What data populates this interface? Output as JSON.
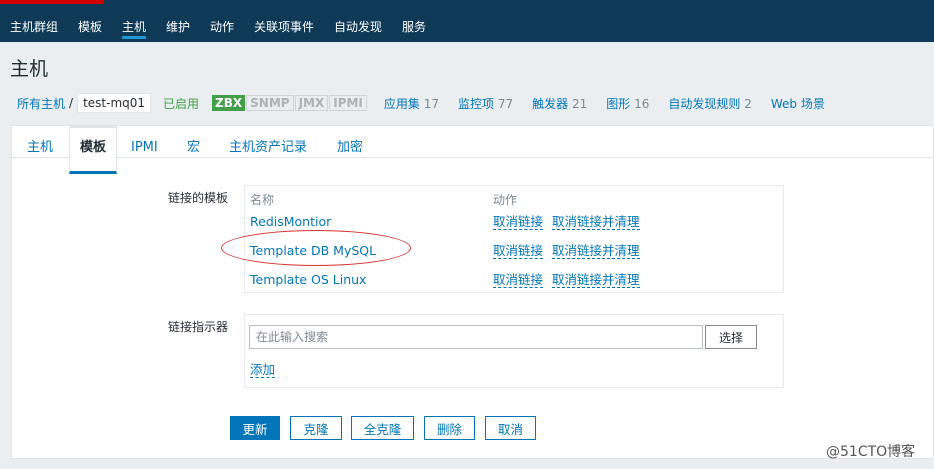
{
  "nav": {
    "items": [
      {
        "label": "主机群组"
      },
      {
        "label": "模板"
      },
      {
        "label": "主机"
      },
      {
        "label": "维护"
      },
      {
        "label": "动作"
      },
      {
        "label": "关联项事件"
      },
      {
        "label": "自动发现"
      },
      {
        "label": "服务"
      }
    ]
  },
  "page": {
    "title": "主机"
  },
  "breadcrumb": {
    "all_hosts": "所有主机",
    "separator": "/",
    "current": "test-mq01",
    "status": "已启用",
    "badges": [
      "ZBX",
      "SNMP",
      "JMX",
      "IPMI"
    ],
    "links": [
      {
        "label": "应用集",
        "count": "17"
      },
      {
        "label": "监控项",
        "count": "77"
      },
      {
        "label": "触发器",
        "count": "21"
      },
      {
        "label": "图形",
        "count": "16"
      },
      {
        "label": "自动发现规则",
        "count": "2"
      },
      {
        "label": "Web 场景",
        "count": ""
      }
    ]
  },
  "tabs": [
    {
      "label": "主机"
    },
    {
      "label": "模板"
    },
    {
      "label": "IPMI"
    },
    {
      "label": "宏"
    },
    {
      "label": "主机资产记录"
    },
    {
      "label": "加密"
    }
  ],
  "linked_templates": {
    "label": "链接的模板",
    "col_name": "名称",
    "col_action": "动作",
    "rows": [
      {
        "name": "RedisMontior",
        "unlink": "取消链接",
        "unlink_clear": "取消链接并清理"
      },
      {
        "name": "Template DB MySQL",
        "unlink": "取消链接",
        "unlink_clear": "取消链接并清理"
      },
      {
        "name": "Template OS Linux",
        "unlink": "取消链接",
        "unlink_clear": "取消链接并清理"
      }
    ]
  },
  "link_indicator": {
    "label": "链接指示器",
    "placeholder": "在此输入搜索",
    "select_button": "选择",
    "add_link": "添加"
  },
  "actions": {
    "update": "更新",
    "clone": "克隆",
    "full_clone": "全克隆",
    "delete": "删除",
    "cancel": "取消"
  },
  "watermark": "@51CTO博客"
}
